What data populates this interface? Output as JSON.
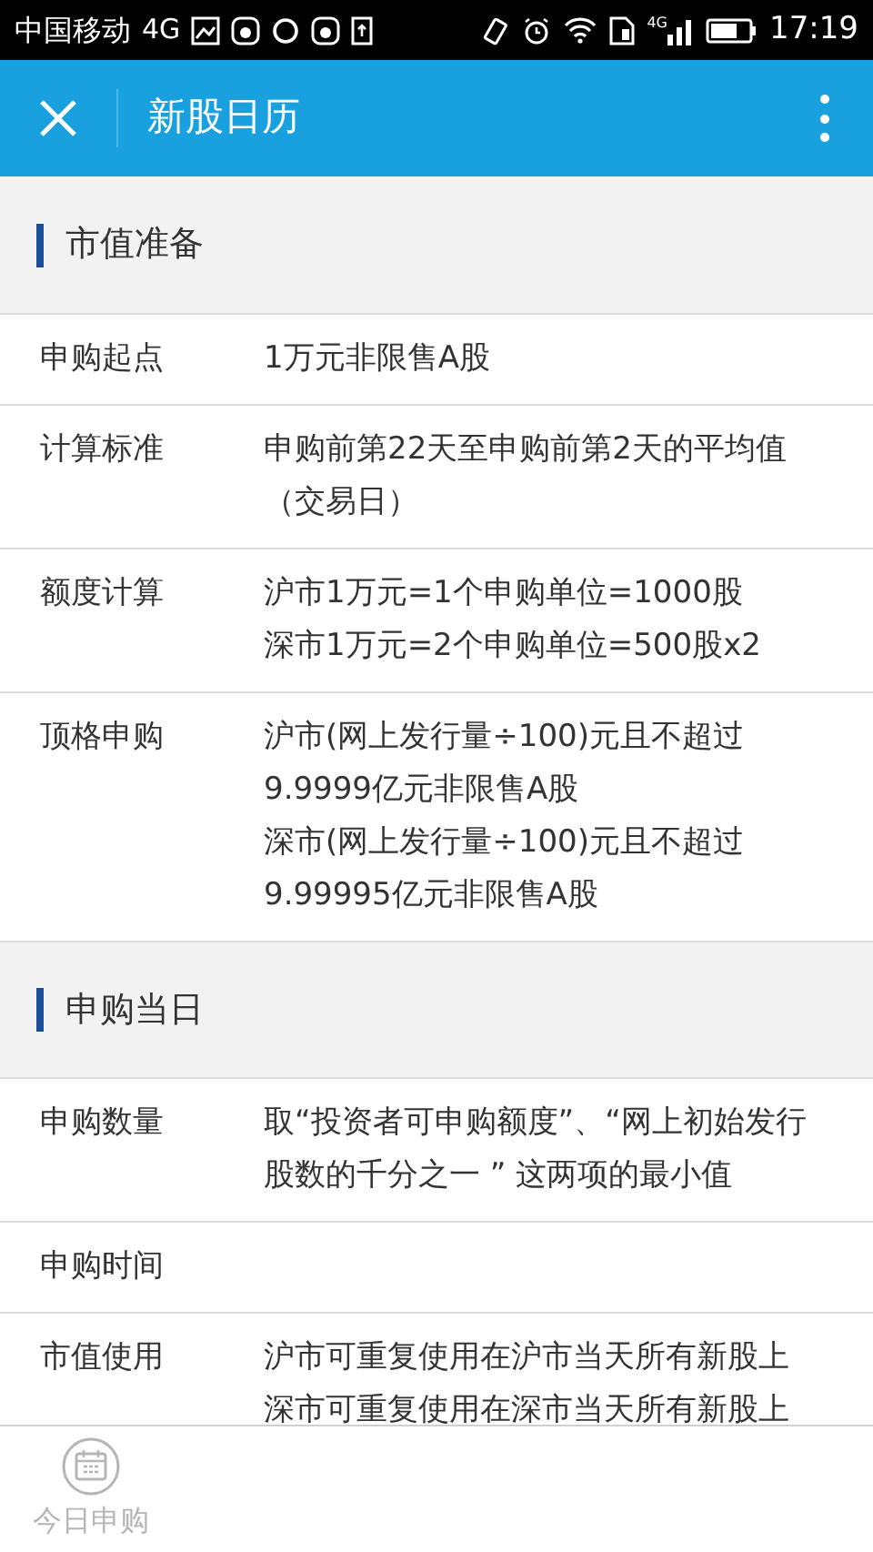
{
  "status_bar": {
    "carrier": "中国移动",
    "network": "4G",
    "signal_label": "4G",
    "time": "17:19"
  },
  "header": {
    "title": "新股日历"
  },
  "sections": [
    {
      "title": "市值准备",
      "rows": [
        {
          "label": "申购起点",
          "lines": [
            "1万元非限售A股"
          ]
        },
        {
          "label": "计算标准",
          "lines": [
            "申购前第22天至申购前第2天的平均值",
            "（交易日）"
          ]
        },
        {
          "label": "额度计算",
          "lines": [
            "沪市1万元=1个申购单位=1000股",
            "深市1万元=2个申购单位=500股x2"
          ]
        },
        {
          "label": "顶格申购",
          "lines": [
            "沪市(网上发行量÷100)元且不超过",
            "9.9999亿元非限售A股",
            "深市(网上发行量÷100)元且不超过",
            "9.99995亿元非限售A股"
          ]
        }
      ]
    },
    {
      "title": "申购当日",
      "rows": [
        {
          "label": "申购数量",
          "lines": [
            "取“投资者可申购额度”、“网上初始发行",
            "股数的千分之一 ” 这两项的最小值"
          ]
        },
        {
          "label": "申购时间",
          "lines": []
        },
        {
          "label": "市值使用",
          "lines": [
            "沪市可重复使用在沪市当天所有新股上",
            "深市可重复使用在深市当天所有新股上"
          ]
        }
      ]
    }
  ],
  "tab_bar": [
    {
      "label": "今日申购",
      "selected": false
    }
  ]
}
